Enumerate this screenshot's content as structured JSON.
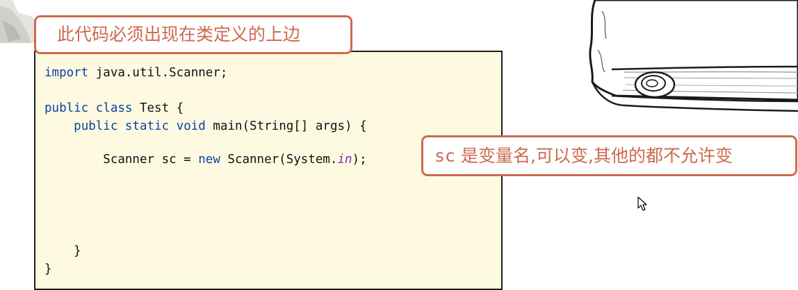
{
  "code": {
    "lines": [
      {
        "segments": [
          {
            "text": "import",
            "type": "kw"
          },
          {
            "text": " java.util.Scanner;",
            "type": "plain"
          }
        ]
      },
      {
        "segments": [
          {
            "text": "public",
            "type": "kw"
          },
          {
            "text": " ",
            "type": "plain"
          },
          {
            "text": "class",
            "type": "kw"
          },
          {
            "text": " Test {",
            "type": "plain"
          }
        ]
      },
      {
        "segments": [
          {
            "text": "    ",
            "type": "plain"
          },
          {
            "text": "public",
            "type": "kw"
          },
          {
            "text": " ",
            "type": "plain"
          },
          {
            "text": "static",
            "type": "kw"
          },
          {
            "text": " ",
            "type": "plain"
          },
          {
            "text": "void",
            "type": "kw"
          },
          {
            "text": " main(String[] args) {",
            "type": "plain"
          }
        ]
      },
      {
        "segments": [
          {
            "text": "        Scanner sc = ",
            "type": "plain"
          },
          {
            "text": "new",
            "type": "kw"
          },
          {
            "text": " Scanner(System.",
            "type": "plain"
          },
          {
            "text": "in",
            "type": "italic-field"
          },
          {
            "text": ");",
            "type": "plain"
          }
        ]
      },
      {
        "segments": [
          {
            "text": "    }",
            "type": "plain"
          }
        ]
      },
      {
        "segments": [
          {
            "text": "}",
            "type": "plain"
          }
        ]
      }
    ]
  },
  "annotations": {
    "import_note": "此代码必须出现在类定义的上边",
    "variable_note_code": "sc",
    "variable_note_text": " 是变量名,可以变,其他的都不允许变"
  },
  "colors": {
    "keyword": "#0a3fa8",
    "field_italic": "#7b2fb0",
    "callout_accent": "#cd6a4d",
    "code_background": "#fefae1"
  },
  "icons": {
    "cursor": "mouse-pointer-icon",
    "scroll": "paper-scroll-illustration",
    "corner": "decorative-corner-image"
  }
}
